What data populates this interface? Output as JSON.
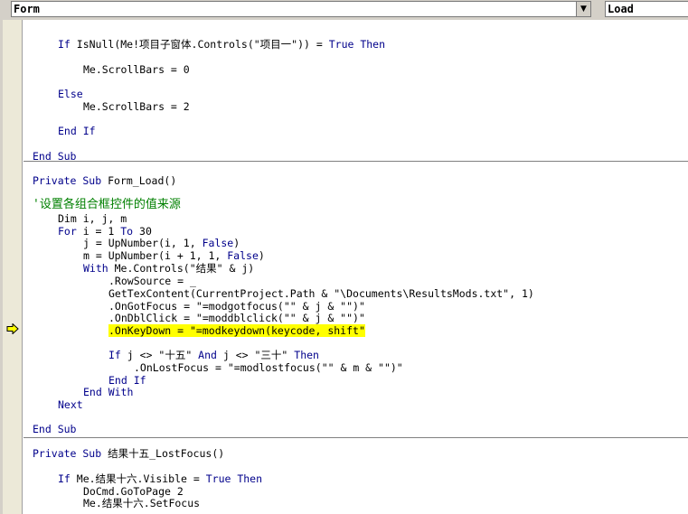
{
  "header": {
    "object_combo": "Form",
    "procedure_combo": "Load",
    "dropdown_glyph": "▼"
  },
  "colors": {
    "keyword": "#00008b",
    "comment": "#008000",
    "highlight": "#ffff00",
    "arrow": "#ffff00"
  },
  "icons": {
    "execution_pointer": "yellow-arrow-icon"
  },
  "code": {
    "l1": {
      "a": "If ",
      "b": "IsNull(Me!项目子窗体.Controls(\"项目一\")) = ",
      "c": "True Then"
    },
    "l2": "Me.ScrollBars = 0",
    "l3": "Else",
    "l4": "Me.ScrollBars = 2",
    "l5": "End If",
    "l6": "End Sub",
    "l7": {
      "a": "Private Sub ",
      "b": "Form_Load()"
    },
    "l8": "'设置各组合框控件的值来源",
    "l9": "Dim i, j, m",
    "l10": {
      "a": "For ",
      "b": "i = 1 ",
      "c": "To ",
      "d": "30"
    },
    "l11": {
      "a": "j = UpNumber(i, 1, ",
      "b": "False",
      "c": ")"
    },
    "l12": {
      "a": "m = UpNumber(i + 1, 1, ",
      "b": "False",
      "c": ")"
    },
    "l13": {
      "a": "With ",
      "b": "Me.Controls(\"结果\" & j)"
    },
    "l14": ".RowSource = _",
    "l15": "GetTexContent(CurrentProject.Path & \"\\Documents\\ResultsMods.txt\", 1)",
    "l16": ".OnGotFocus = \"=modgotfocus(\"\" & j & \"\")\"",
    "l17": ".OnDblClick = \"=moddblclick(\"\" & j & \"\")\"",
    "l18": ".OnKeyDown = \"=modkeydown(keycode, shift\"",
    "l19": {
      "a": "If ",
      "b": "j <> \"十五\" ",
      "c": "And ",
      "d": "j <> \"三十\" ",
      "e": "Then"
    },
    "l20": ".OnLostFocus = \"=modlostfocus(\"\" & m & \"\")\"",
    "l21": "End If",
    "l22": "End With",
    "l23": "Next",
    "l24": "End Sub",
    "l25": {
      "a": "Private Sub ",
      "b": "结果十五_LostFocus()"
    },
    "l26": {
      "a": "If ",
      "b": "Me.结果十六.Visible = ",
      "c": "True Then"
    },
    "l27": "DoCmd.GoToPage 2",
    "l28": "Me.结果十六.SetFocus"
  }
}
